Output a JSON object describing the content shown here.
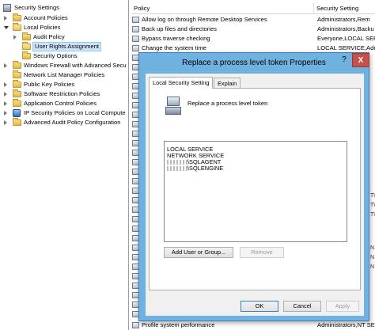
{
  "tree": {
    "root": "Security Settings",
    "items": [
      {
        "label": "Account Policies"
      },
      {
        "label": "Local Policies"
      },
      {
        "label": "Audit Policy"
      },
      {
        "label": "User Rights Assignment"
      },
      {
        "label": "Security Options"
      },
      {
        "label": "Windows Firewall with Advanced Secu"
      },
      {
        "label": "Network List Manager Policies"
      },
      {
        "label": "Public Key Policies"
      },
      {
        "label": "Software Restriction Policies"
      },
      {
        "label": "Application Control Policies"
      },
      {
        "label": "IP Security Policies on Local Compute"
      },
      {
        "label": "Advanced Audit Policy Configuration"
      }
    ]
  },
  "list": {
    "columns": {
      "policy": "Policy",
      "setting": "Security Setting"
    },
    "rows": [
      {
        "policy": "Allow log on through Remote Desktop Services",
        "setting": "Administrators,Rem"
      },
      {
        "policy": "Back up files and directories",
        "setting": "Administrators,Backu"
      },
      {
        "policy": "Bypass traverse checking",
        "setting": "Everyone,LOCAL SERV"
      },
      {
        "policy": "Change the system time",
        "setting": "LOCAL SERVICE,Admi"
      }
    ],
    "bottom_row": {
      "policy": "Profile system performance",
      "setting": "Administrators,NT SE"
    },
    "right_fragments": [
      "T\\",
      "T\\",
      "T\\",
      "N",
      "N",
      "N"
    ]
  },
  "dialog": {
    "title": "Replace a process level token Properties",
    "help_glyph": "?",
    "close_glyph": "X",
    "tabs": [
      "Local Security Setting",
      "Explain"
    ],
    "policy_name": "Replace a process level token",
    "accounts": [
      {
        "prefix": "",
        "name": "LOCAL SERVICE"
      },
      {
        "prefix": "",
        "name": "NETWORK SERVICE"
      },
      {
        "prefix": "",
        "name": "\\SQLAGENT"
      },
      {
        "prefix": "",
        "name": "\\SQLENGINE"
      }
    ],
    "buttons": {
      "add": "Add User or Group...",
      "remove": "Remove",
      "ok": "OK",
      "cancel": "Cancel",
      "apply": "Apply"
    }
  }
}
